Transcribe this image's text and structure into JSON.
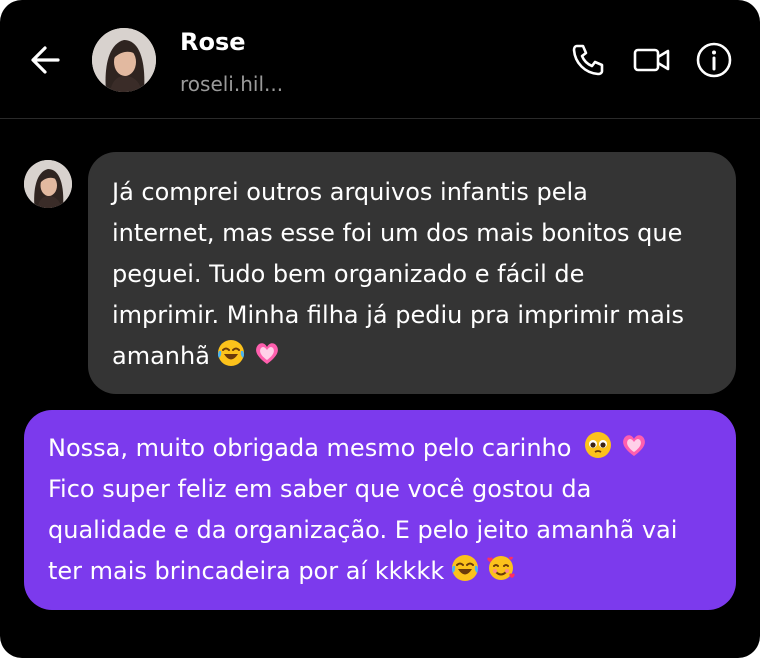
{
  "header": {
    "name": "Rose",
    "username": "roseli.hil...",
    "icons": [
      "back-arrow-icon",
      "phone-icon",
      "video-camera-icon",
      "info-icon"
    ]
  },
  "messages": [
    {
      "direction": "incoming",
      "lines": [
        "Já comprei outros arquivos infantis pela",
        "internet, mas esse foi um dos mais bonitos que",
        "peguei. Tudo bem organizado e fácil de",
        "imprimir. Minha filha já pediu pra imprimir mais",
        "amanhã"
      ],
      "emojis": [
        "joy-emoji",
        "heart-emoji"
      ]
    },
    {
      "direction": "outgoing",
      "lines": [
        "Nossa, muito obrigada mesmo pelo carinho",
        "Fico super feliz em saber que você gostou da",
        "qualidade e da organização. E pelo jeito amanhã vai",
        "ter mais brincadeira por aí kkkkk"
      ],
      "emojis": [
        "pleading-emoji",
        "heart-emoji",
        "joy-emoji",
        "smiling-hearts-emoji"
      ]
    }
  ],
  "colors": {
    "background": "#000000",
    "incoming_bubble": "#343434",
    "outgoing_bubble": "#7c3aed",
    "username_text": "#9a9a9a"
  }
}
